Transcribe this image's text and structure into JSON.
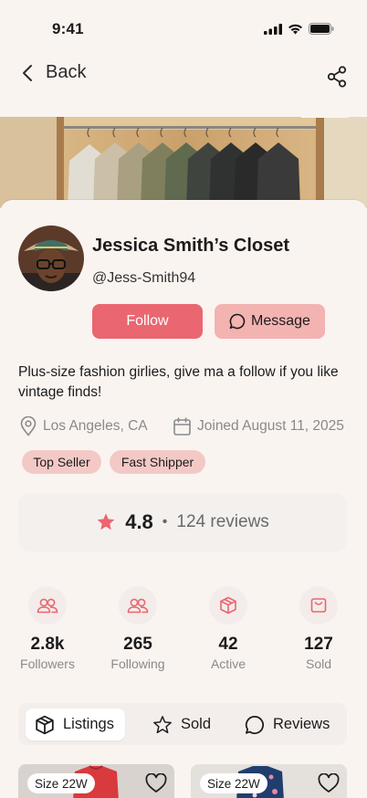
{
  "status_bar": {
    "time": "9:41"
  },
  "nav": {
    "back_label": "Back"
  },
  "profile": {
    "name": "Jessica Smith’s Closet",
    "handle": "@Jess-Smith94",
    "follow_label": "Follow",
    "message_label": "Message",
    "bio": "Plus-size fashion girlies, give ma a follow if you like vintage finds!",
    "location": "Los Angeles, CA",
    "joined": "Joined August 11, 2025",
    "badges": [
      "Top Seller",
      "Fast Shipper"
    ]
  },
  "rating": {
    "value": "4.8",
    "separator": "•",
    "count": "124 reviews"
  },
  "stats": [
    {
      "icon": "users-icon",
      "value": "2.8k",
      "label": "Followers"
    },
    {
      "icon": "users-icon",
      "value": "265",
      "label": "Following"
    },
    {
      "icon": "box-icon",
      "value": "42",
      "label": "Active"
    },
    {
      "icon": "bag-icon",
      "value": "127",
      "label": "Sold"
    }
  ],
  "tabs": [
    {
      "label": "Listings",
      "icon": "box-icon",
      "active": true
    },
    {
      "label": "Sold",
      "icon": "star-icon",
      "active": false
    },
    {
      "label": "Reviews",
      "icon": "chat-icon",
      "active": false
    }
  ],
  "listings": [
    {
      "size": "Size 22W"
    },
    {
      "size": "Size 22W"
    }
  ],
  "colors": {
    "accent": "#ea6670",
    "accent_soft": "#f3b3b1",
    "badge": "#f3c9c6",
    "background": "#faf4f1"
  }
}
